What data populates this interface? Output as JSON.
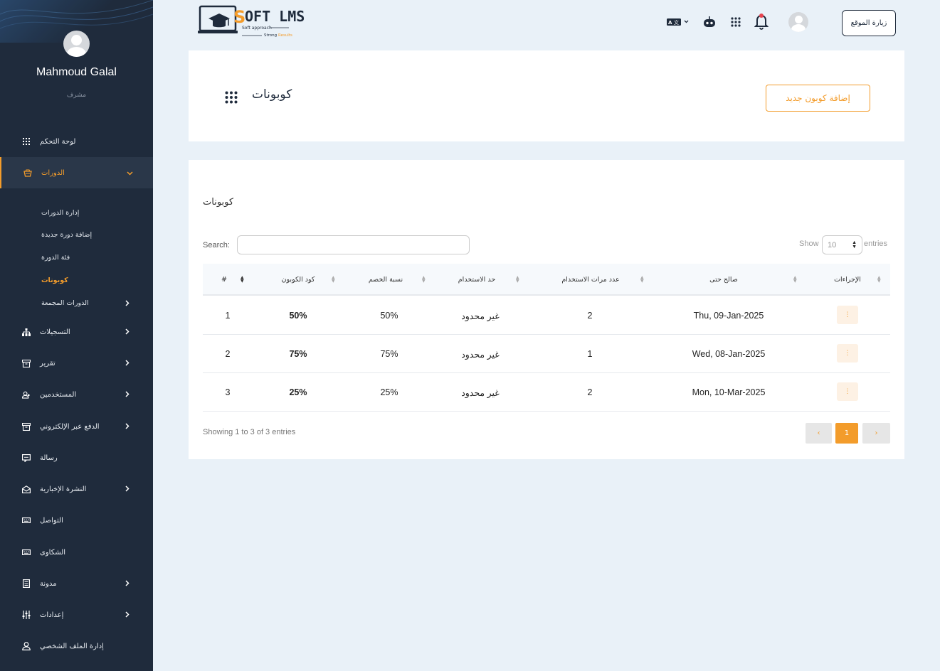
{
  "profile": {
    "name": "Mahmoud Galal",
    "role": "مشرف"
  },
  "sidebar": {
    "items": [
      {
        "label": "لوحة التحكم",
        "icon": "grid-icon"
      },
      {
        "label": "الدورات",
        "icon": "basket-icon",
        "active": true
      },
      {
        "label": "التسجيلات",
        "icon": "sitemap-icon"
      },
      {
        "label": "تقرير",
        "icon": "box-icon"
      },
      {
        "label": "المستخدمين",
        "icon": "users-icon"
      },
      {
        "label": "الدفع عبر الإلكتروني",
        "icon": "box-icon"
      },
      {
        "label": "رسالة",
        "icon": "message-icon"
      },
      {
        "label": "النشرة الإخبارية",
        "icon": "mail-open-icon"
      },
      {
        "label": "التواصل",
        "icon": "keyboard-icon"
      },
      {
        "label": "الشكاوى",
        "icon": "keyboard-icon"
      },
      {
        "label": "مدونة",
        "icon": "document-icon"
      },
      {
        "label": "إعدادات",
        "icon": "sliders-icon"
      },
      {
        "label": "إدارة الملف الشخصي",
        "icon": "user-icon"
      }
    ],
    "sub_items": [
      {
        "label": "إدارة الدورات"
      },
      {
        "label": "إضافة دورة جديدة"
      },
      {
        "label": "فئة الدورة"
      },
      {
        "label": "كوبونات",
        "current": true
      },
      {
        "label": "الدورات المجمعة"
      }
    ]
  },
  "header": {
    "logo_text": "SOFT LMS",
    "logo_tagline_1": "Soft approach",
    "logo_tagline_2": "Strong Results",
    "visit_site": "زيارة الموقع"
  },
  "page": {
    "title": "كوبونات",
    "add_button": "إضافة كوبون جديد"
  },
  "table": {
    "card_title": "كوبونات",
    "search_label": "Search:",
    "show_label": "Show",
    "entries_value": "10",
    "entries_label": "entries",
    "columns": [
      "#",
      "كود الكوبون",
      "نسبة الخصم",
      "حد الاستخدام",
      "عدد مرات الاستخدام",
      "صالح حتى",
      "الإجراءات"
    ],
    "rows": [
      {
        "num": "1",
        "code": "50%",
        "discount": "50%",
        "limit": "غير محدود",
        "used": "2",
        "valid_until": "Thu, 09-Jan-2025"
      },
      {
        "num": "2",
        "code": "75%",
        "discount": "75%",
        "limit": "غير محدود",
        "used": "1",
        "valid_until": "Wed, 08-Jan-2025"
      },
      {
        "num": "3",
        "code": "25%",
        "discount": "25%",
        "limit": "غير محدود",
        "used": "2",
        "valid_until": "Mon, 10-Mar-2025"
      }
    ],
    "footer_info": "Showing 1 to 3 of 3 entries",
    "pagination": {
      "prev": "‹",
      "current": "1",
      "next": "›"
    }
  },
  "colors": {
    "accent": "#f39c2b",
    "sidebar": "#1f2b3c",
    "background": "#e9f1f8"
  }
}
